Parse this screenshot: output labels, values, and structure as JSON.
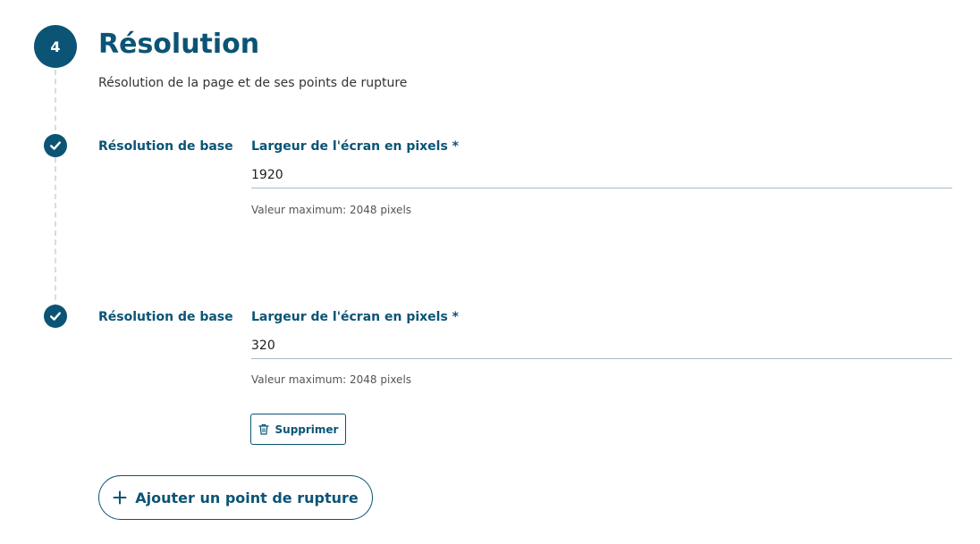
{
  "step": {
    "number": "4",
    "title": "Résolution",
    "subtitle": "Résolution de la page et de ses points de rupture"
  },
  "breakpoints": [
    {
      "label": "Résolution de base",
      "field_label": "Largeur de l'écran en pixels *",
      "value": "1920",
      "help": "Valeur maximum: 2048 pixels"
    },
    {
      "label": "Résolution de base",
      "field_label": "Largeur de l'écran en pixels *",
      "value": "320",
      "help": "Valeur maximum: 2048 pixels",
      "delete_label": "Supprimer"
    }
  ],
  "actions": {
    "add_label": "Ajouter un point de rupture"
  },
  "icons": {
    "check": "check-icon",
    "trash": "trash-icon",
    "plus": "plus-icon"
  },
  "colors": {
    "accent": "#0b5475",
    "timeline": "#d3dde6",
    "input_border": "#a8bcc8"
  }
}
